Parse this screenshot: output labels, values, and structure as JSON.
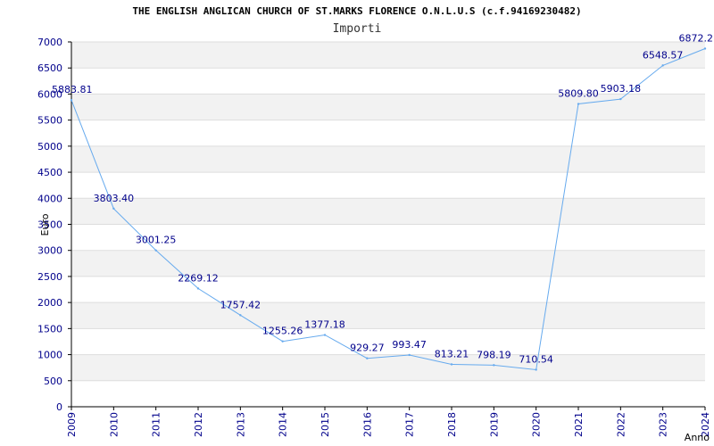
{
  "title": "THE ENGLISH ANGLICAN CHURCH OF ST.MARKS FLORENCE O.N.L.U.S (c.f.94169230482)",
  "subtitle": "Importi",
  "colors": {
    "line": "#66aaee",
    "tick_text": "#00008b",
    "band": "#f2f2f2",
    "grid": "#dddddd",
    "axis": "#000000"
  },
  "chart_data": {
    "type": "line",
    "x": [
      "2009",
      "2010",
      "2011",
      "2012",
      "2013",
      "2014",
      "2015",
      "2016",
      "2017",
      "2018",
      "2019",
      "2020",
      "2021",
      "2022",
      "2023",
      "2024"
    ],
    "series": [
      {
        "values": [
          5883.81,
          3803.4,
          3001.25,
          2269.12,
          1757.42,
          1255.26,
          1377.18,
          929.27,
          993.47,
          813.21,
          798.19,
          710.54,
          5809.8,
          5903.18,
          6548.57,
          6872.2
        ],
        "labels": [
          "5883.81",
          "3803.40",
          "3001.25",
          "2269.12",
          "1757.42",
          "1255.26",
          "1377.18",
          "929.27",
          "993.47",
          "813.21",
          "798.19",
          "710.54",
          "5809.80",
          "5903.18",
          "6548.57",
          "6872.2"
        ]
      }
    ],
    "ylabel": "Euro",
    "xlabel": "Anno",
    "ylim": [
      0,
      7000
    ],
    "yticks": [
      "0",
      "500",
      "1000",
      "1500",
      "2000",
      "2500",
      "3000",
      "3500",
      "4000",
      "4500",
      "5000",
      "5500",
      "6000",
      "6500",
      "7000"
    ],
    "grid": true
  }
}
